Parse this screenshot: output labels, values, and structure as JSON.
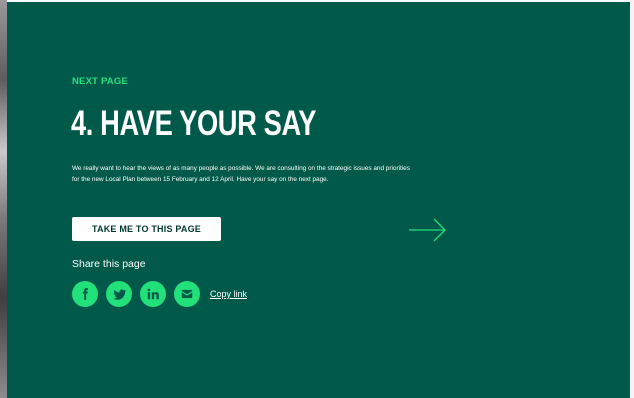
{
  "next": {
    "kicker": "NEXT PAGE",
    "heading": "4. HAVE YOUR SAY",
    "description": "We really want to hear the views of as many people as possible. We are consulting on the strategic issues and priorities for the new Local Plan between 15 February and 12 April. Have your say on the next page.",
    "cta_label": "TAKE ME TO THIS PAGE"
  },
  "share": {
    "label": "Share this page",
    "icons": [
      "facebook-icon",
      "twitter-icon",
      "linkedin-icon",
      "email-icon"
    ],
    "copy_label": "Copy link"
  },
  "colors": {
    "panel": "#01594a",
    "accent": "#22e07a",
    "text": "#ffffff"
  }
}
